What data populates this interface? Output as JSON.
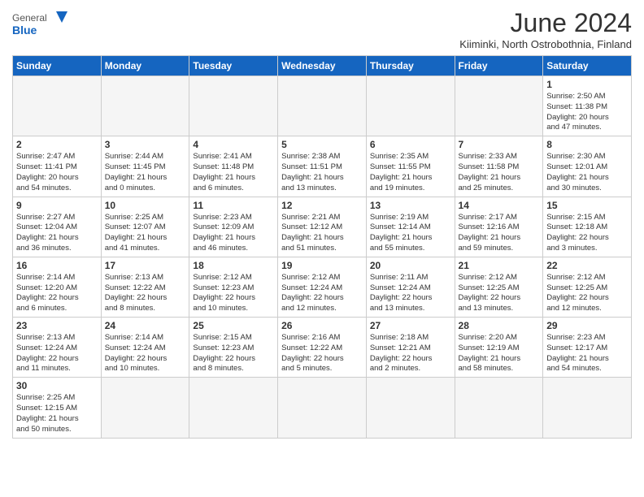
{
  "header": {
    "title": "June 2024",
    "location": "Kiiminki, North Ostrobothnia, Finland",
    "logo_general": "General",
    "logo_blue": "Blue"
  },
  "columns": [
    "Sunday",
    "Monday",
    "Tuesday",
    "Wednesday",
    "Thursday",
    "Friday",
    "Saturday"
  ],
  "weeks": [
    [
      {
        "day": "",
        "info": ""
      },
      {
        "day": "",
        "info": ""
      },
      {
        "day": "",
        "info": ""
      },
      {
        "day": "",
        "info": ""
      },
      {
        "day": "",
        "info": ""
      },
      {
        "day": "",
        "info": ""
      },
      {
        "day": "1",
        "info": "Sunrise: 2:50 AM\nSunset: 11:38 PM\nDaylight: 20 hours\nand 47 minutes."
      }
    ],
    [
      {
        "day": "2",
        "info": "Sunrise: 2:47 AM\nSunset: 11:41 PM\nDaylight: 20 hours\nand 54 minutes."
      },
      {
        "day": "3",
        "info": "Sunrise: 2:44 AM\nSunset: 11:45 PM\nDaylight: 21 hours\nand 0 minutes."
      },
      {
        "day": "4",
        "info": "Sunrise: 2:41 AM\nSunset: 11:48 PM\nDaylight: 21 hours\nand 6 minutes."
      },
      {
        "day": "5",
        "info": "Sunrise: 2:38 AM\nSunset: 11:51 PM\nDaylight: 21 hours\nand 13 minutes."
      },
      {
        "day": "6",
        "info": "Sunrise: 2:35 AM\nSunset: 11:55 PM\nDaylight: 21 hours\nand 19 minutes."
      },
      {
        "day": "7",
        "info": "Sunrise: 2:33 AM\nSunset: 11:58 PM\nDaylight: 21 hours\nand 25 minutes."
      },
      {
        "day": "8",
        "info": "Sunrise: 2:30 AM\nSunset: 12:01 AM\nDaylight: 21 hours\nand 30 minutes."
      }
    ],
    [
      {
        "day": "9",
        "info": "Sunrise: 2:27 AM\nSunset: 12:04 AM\nDaylight: 21 hours\nand 36 minutes."
      },
      {
        "day": "10",
        "info": "Sunrise: 2:25 AM\nSunset: 12:07 AM\nDaylight: 21 hours\nand 41 minutes."
      },
      {
        "day": "11",
        "info": "Sunrise: 2:23 AM\nSunset: 12:09 AM\nDaylight: 21 hours\nand 46 minutes."
      },
      {
        "day": "12",
        "info": "Sunrise: 2:21 AM\nSunset: 12:12 AM\nDaylight: 21 hours\nand 51 minutes."
      },
      {
        "day": "13",
        "info": "Sunrise: 2:19 AM\nSunset: 12:14 AM\nDaylight: 21 hours\nand 55 minutes."
      },
      {
        "day": "14",
        "info": "Sunrise: 2:17 AM\nSunset: 12:16 AM\nDaylight: 21 hours\nand 59 minutes."
      },
      {
        "day": "15",
        "info": "Sunrise: 2:15 AM\nSunset: 12:18 AM\nDaylight: 22 hours\nand 3 minutes."
      }
    ],
    [
      {
        "day": "16",
        "info": "Sunrise: 2:14 AM\nSunset: 12:20 AM\nDaylight: 22 hours\nand 6 minutes."
      },
      {
        "day": "17",
        "info": "Sunrise: 2:13 AM\nSunset: 12:22 AM\nDaylight: 22 hours\nand 8 minutes."
      },
      {
        "day": "18",
        "info": "Sunrise: 2:12 AM\nSunset: 12:23 AM\nDaylight: 22 hours\nand 10 minutes."
      },
      {
        "day": "19",
        "info": "Sunrise: 2:12 AM\nSunset: 12:24 AM\nDaylight: 22 hours\nand 12 minutes."
      },
      {
        "day": "20",
        "info": "Sunrise: 2:11 AM\nSunset: 12:24 AM\nDaylight: 22 hours\nand 13 minutes."
      },
      {
        "day": "21",
        "info": "Sunrise: 2:12 AM\nSunset: 12:25 AM\nDaylight: 22 hours\nand 13 minutes."
      },
      {
        "day": "22",
        "info": "Sunrise: 2:12 AM\nSunset: 12:25 AM\nDaylight: 22 hours\nand 12 minutes."
      }
    ],
    [
      {
        "day": "23",
        "info": "Sunrise: 2:13 AM\nSunset: 12:24 AM\nDaylight: 22 hours\nand 11 minutes."
      },
      {
        "day": "24",
        "info": "Sunrise: 2:14 AM\nSunset: 12:24 AM\nDaylight: 22 hours\nand 10 minutes."
      },
      {
        "day": "25",
        "info": "Sunrise: 2:15 AM\nSunset: 12:23 AM\nDaylight: 22 hours\nand 8 minutes."
      },
      {
        "day": "26",
        "info": "Sunrise: 2:16 AM\nSunset: 12:22 AM\nDaylight: 22 hours\nand 5 minutes."
      },
      {
        "day": "27",
        "info": "Sunrise: 2:18 AM\nSunset: 12:21 AM\nDaylight: 22 hours\nand 2 minutes."
      },
      {
        "day": "28",
        "info": "Sunrise: 2:20 AM\nSunset: 12:19 AM\nDaylight: 21 hours\nand 58 minutes."
      },
      {
        "day": "29",
        "info": "Sunrise: 2:23 AM\nSunset: 12:17 AM\nDaylight: 21 hours\nand 54 minutes."
      }
    ],
    [
      {
        "day": "30",
        "info": "Sunrise: 2:25 AM\nSunset: 12:15 AM\nDaylight: 21 hours\nand 50 minutes."
      },
      {
        "day": "",
        "info": ""
      },
      {
        "day": "",
        "info": ""
      },
      {
        "day": "",
        "info": ""
      },
      {
        "day": "",
        "info": ""
      },
      {
        "day": "",
        "info": ""
      },
      {
        "day": "",
        "info": ""
      }
    ]
  ]
}
